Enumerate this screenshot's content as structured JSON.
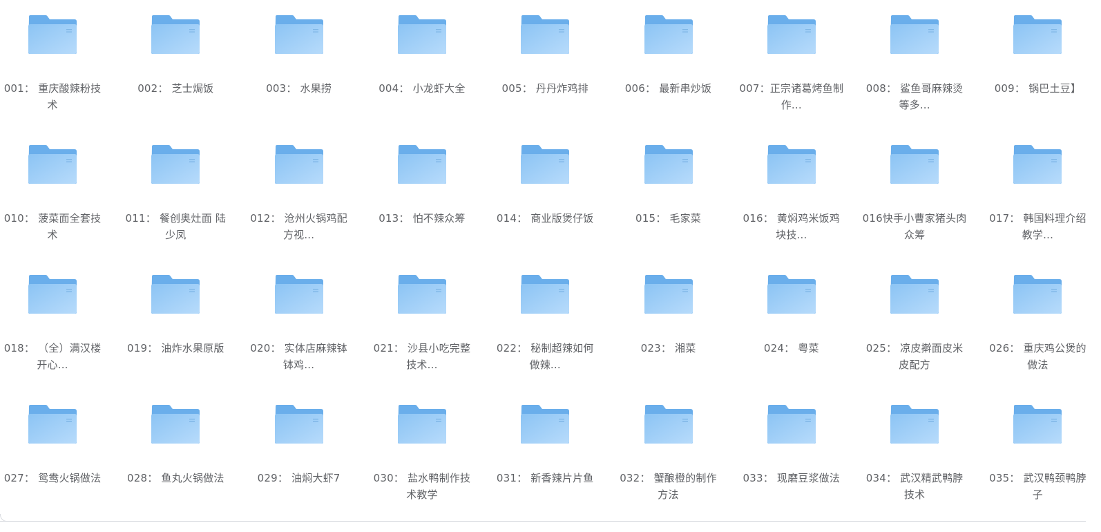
{
  "folders": [
    {
      "name": "001： 重庆酸辣粉技术"
    },
    {
      "name": "002： 芝士焗饭"
    },
    {
      "name": "003： 水果捞"
    },
    {
      "name": "004： 小龙虾大全"
    },
    {
      "name": "005： 丹丹炸鸡排"
    },
    {
      "name": "006： 最新串炒饭"
    },
    {
      "name": "007：正宗诸葛烤鱼制作..."
    },
    {
      "name": "008： 鲨鱼哥麻辣烫等多..."
    },
    {
      "name": "009： 锅巴土豆】"
    },
    {
      "name": "010： 菠菜面全套技术"
    },
    {
      "name": "011： 餐创奥灶面 陆少凤"
    },
    {
      "name": "012： 沧州火锅鸡配方视..."
    },
    {
      "name": "013： 怕不辣众筹"
    },
    {
      "name": "014： 商业版煲仔饭"
    },
    {
      "name": "015： 毛家菜"
    },
    {
      "name": "016： 黄焖鸡米饭鸡块技..."
    },
    {
      "name": "016快手小曹家猪头肉众筹"
    },
    {
      "name": "017： 韩国料理介绍教学..."
    },
    {
      "name": "018： （全）满汉楼开心..."
    },
    {
      "name": "019： 油炸水果原版"
    },
    {
      "name": "020： 实体店麻辣钵钵鸡..."
    },
    {
      "name": "021： 沙县小吃完整技术..."
    },
    {
      "name": "022： 秘制超辣如何做辣..."
    },
    {
      "name": "023： 湘菜"
    },
    {
      "name": "024： 粤菜"
    },
    {
      "name": "025： 凉皮擀面皮米皮配方"
    },
    {
      "name": "026： 重庆鸡公煲的做法"
    },
    {
      "name": "027： 鸳鸯火锅做法"
    },
    {
      "name": "028： 鱼丸火锅做法"
    },
    {
      "name": "029： 油焖大虾7"
    },
    {
      "name": "030： 盐水鸭制作技术教学"
    },
    {
      "name": "031： 新香辣片片鱼"
    },
    {
      "name": "032： 蟹酿橙的制作方法"
    },
    {
      "name": "033： 现磨豆浆做法"
    },
    {
      "name": "034： 武汉精武鸭脖技术"
    },
    {
      "name": "035： 武汉鸭颈鸭脖子"
    }
  ],
  "colors": {
    "folder_back": "#6aaeeb",
    "folder_front_top": "#8cc4f4",
    "folder_front_bottom": "#b7dbfb",
    "text": "#606266"
  },
  "icon": "folder-icon"
}
